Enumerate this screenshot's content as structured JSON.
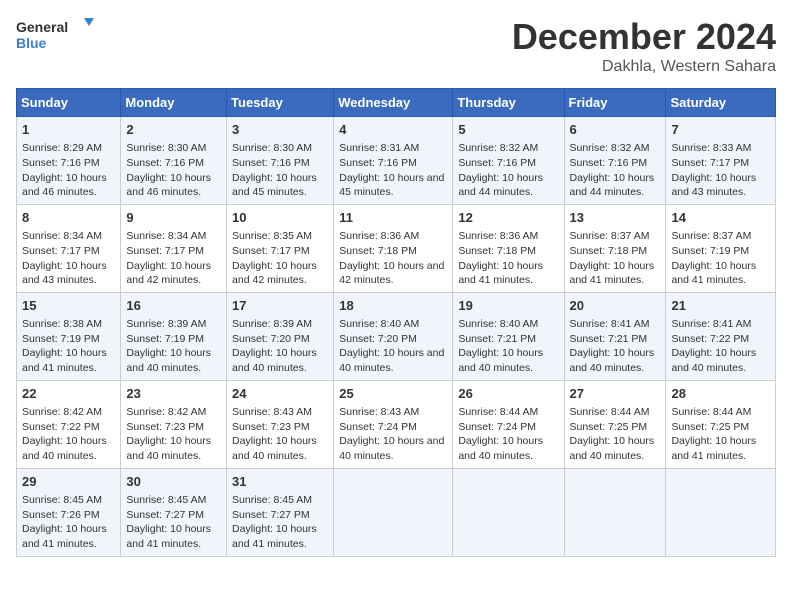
{
  "logo": {
    "line1": "General",
    "line2": "Blue"
  },
  "title": "December 2024",
  "location": "Dakhla, Western Sahara",
  "headers": [
    "Sunday",
    "Monday",
    "Tuesday",
    "Wednesday",
    "Thursday",
    "Friday",
    "Saturday"
  ],
  "weeks": [
    [
      {
        "day": "1",
        "sunrise": "8:29 AM",
        "sunset": "7:16 PM",
        "daylight": "10 hours and 46 minutes."
      },
      {
        "day": "2",
        "sunrise": "8:30 AM",
        "sunset": "7:16 PM",
        "daylight": "10 hours and 46 minutes."
      },
      {
        "day": "3",
        "sunrise": "8:30 AM",
        "sunset": "7:16 PM",
        "daylight": "10 hours and 45 minutes."
      },
      {
        "day": "4",
        "sunrise": "8:31 AM",
        "sunset": "7:16 PM",
        "daylight": "10 hours and 45 minutes."
      },
      {
        "day": "5",
        "sunrise": "8:32 AM",
        "sunset": "7:16 PM",
        "daylight": "10 hours and 44 minutes."
      },
      {
        "day": "6",
        "sunrise": "8:32 AM",
        "sunset": "7:16 PM",
        "daylight": "10 hours and 44 minutes."
      },
      {
        "day": "7",
        "sunrise": "8:33 AM",
        "sunset": "7:17 PM",
        "daylight": "10 hours and 43 minutes."
      }
    ],
    [
      {
        "day": "8",
        "sunrise": "8:34 AM",
        "sunset": "7:17 PM",
        "daylight": "10 hours and 43 minutes."
      },
      {
        "day": "9",
        "sunrise": "8:34 AM",
        "sunset": "7:17 PM",
        "daylight": "10 hours and 42 minutes."
      },
      {
        "day": "10",
        "sunrise": "8:35 AM",
        "sunset": "7:17 PM",
        "daylight": "10 hours and 42 minutes."
      },
      {
        "day": "11",
        "sunrise": "8:36 AM",
        "sunset": "7:18 PM",
        "daylight": "10 hours and 42 minutes."
      },
      {
        "day": "12",
        "sunrise": "8:36 AM",
        "sunset": "7:18 PM",
        "daylight": "10 hours and 41 minutes."
      },
      {
        "day": "13",
        "sunrise": "8:37 AM",
        "sunset": "7:18 PM",
        "daylight": "10 hours and 41 minutes."
      },
      {
        "day": "14",
        "sunrise": "8:37 AM",
        "sunset": "7:19 PM",
        "daylight": "10 hours and 41 minutes."
      }
    ],
    [
      {
        "day": "15",
        "sunrise": "8:38 AM",
        "sunset": "7:19 PM",
        "daylight": "10 hours and 41 minutes."
      },
      {
        "day": "16",
        "sunrise": "8:39 AM",
        "sunset": "7:19 PM",
        "daylight": "10 hours and 40 minutes."
      },
      {
        "day": "17",
        "sunrise": "8:39 AM",
        "sunset": "7:20 PM",
        "daylight": "10 hours and 40 minutes."
      },
      {
        "day": "18",
        "sunrise": "8:40 AM",
        "sunset": "7:20 PM",
        "daylight": "10 hours and 40 minutes."
      },
      {
        "day": "19",
        "sunrise": "8:40 AM",
        "sunset": "7:21 PM",
        "daylight": "10 hours and 40 minutes."
      },
      {
        "day": "20",
        "sunrise": "8:41 AM",
        "sunset": "7:21 PM",
        "daylight": "10 hours and 40 minutes."
      },
      {
        "day": "21",
        "sunrise": "8:41 AM",
        "sunset": "7:22 PM",
        "daylight": "10 hours and 40 minutes."
      }
    ],
    [
      {
        "day": "22",
        "sunrise": "8:42 AM",
        "sunset": "7:22 PM",
        "daylight": "10 hours and 40 minutes."
      },
      {
        "day": "23",
        "sunrise": "8:42 AM",
        "sunset": "7:23 PM",
        "daylight": "10 hours and 40 minutes."
      },
      {
        "day": "24",
        "sunrise": "8:43 AM",
        "sunset": "7:23 PM",
        "daylight": "10 hours and 40 minutes."
      },
      {
        "day": "25",
        "sunrise": "8:43 AM",
        "sunset": "7:24 PM",
        "daylight": "10 hours and 40 minutes."
      },
      {
        "day": "26",
        "sunrise": "8:44 AM",
        "sunset": "7:24 PM",
        "daylight": "10 hours and 40 minutes."
      },
      {
        "day": "27",
        "sunrise": "8:44 AM",
        "sunset": "7:25 PM",
        "daylight": "10 hours and 40 minutes."
      },
      {
        "day": "28",
        "sunrise": "8:44 AM",
        "sunset": "7:25 PM",
        "daylight": "10 hours and 41 minutes."
      }
    ],
    [
      {
        "day": "29",
        "sunrise": "8:45 AM",
        "sunset": "7:26 PM",
        "daylight": "10 hours and 41 minutes."
      },
      {
        "day": "30",
        "sunrise": "8:45 AM",
        "sunset": "7:27 PM",
        "daylight": "10 hours and 41 minutes."
      },
      {
        "day": "31",
        "sunrise": "8:45 AM",
        "sunset": "7:27 PM",
        "daylight": "10 hours and 41 minutes."
      },
      null,
      null,
      null,
      null
    ]
  ],
  "labels": {
    "sunrise": "Sunrise:",
    "sunset": "Sunset:",
    "daylight": "Daylight:"
  }
}
